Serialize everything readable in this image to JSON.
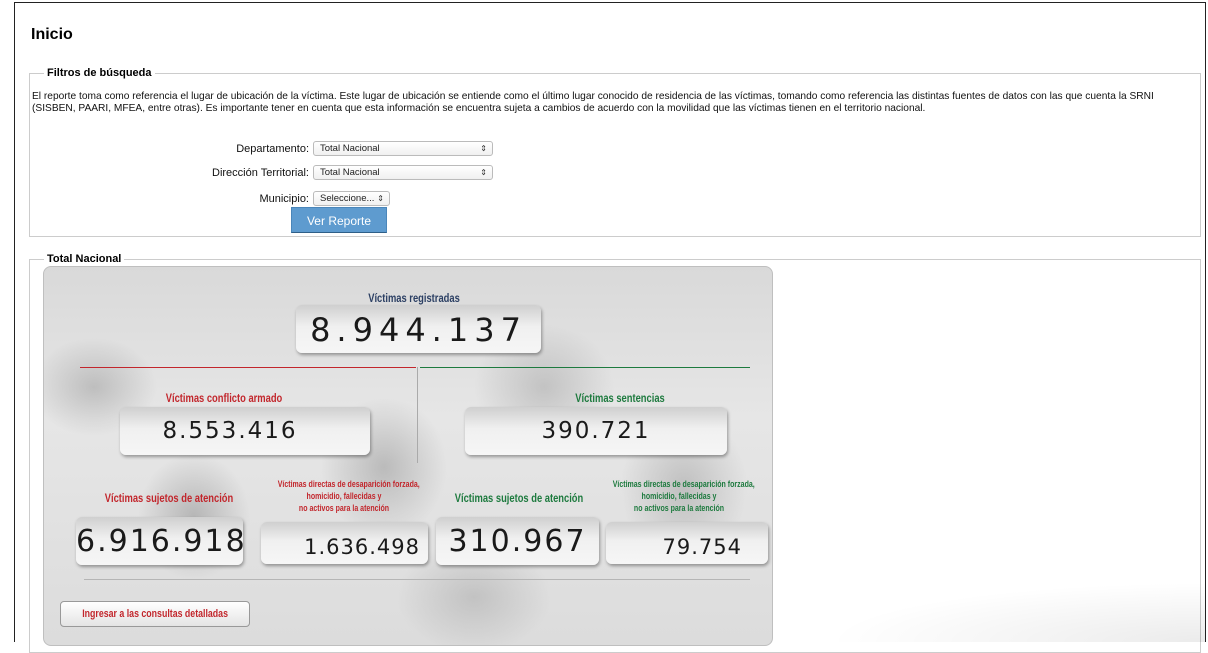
{
  "page": {
    "title": "Inicio"
  },
  "filters": {
    "legend": "Filtros de búsqueda",
    "description": "El reporte toma como referencia el lugar de ubicación de la víctima. Este lugar de ubicación se entiende como el último lugar conocido de residencia de las víctimas, tomando como referencia las distintas fuentes de datos con las que cuenta la SRNI (SISBEN, PAARI, MFEA, entre otras). Es importante tener en cuenta que esta información se encuentra sujeta a cambios de acuerdo con la movilidad que las víctimas tienen en el territorio nacional.",
    "departamento_label": "Departamento:",
    "departamento_value": "Total Nacional",
    "direccion_label": "Dirección Territorial:",
    "direccion_value": "Total Nacional",
    "municipio_label": "Municipio:",
    "municipio_value": "Seleccione...",
    "submit_label": "Ver Reporte"
  },
  "total": {
    "legend": "Total Nacional",
    "registradas_label": "Víctimas registradas",
    "registradas_value": "8.944.137",
    "conflicto_label": "Víctimas conflicto armado",
    "conflicto_value": "8.553.416",
    "sentencias_label": "Víctimas sentencias",
    "sentencias_value": "390.721",
    "sujetos_conflicto_label": "Víctimas sujetos de atención",
    "sujetos_conflicto_value": "6.916.918",
    "directas_conflicto_label_1": "Víctimas directas de desaparición forzada,",
    "directas_conflicto_label_2": "homicidio, fallecidas y",
    "directas_conflicto_label_3": "no activos para la atención",
    "directas_conflicto_value": "1.636.498",
    "sujetos_sentencias_label": "Víctimas sujetos de atención",
    "sujetos_sentencias_value": "310.967",
    "directas_sentencias_label_1": "Víctimas directas de desaparición forzada,",
    "directas_sentencias_label_2": "homicidio, fallecidas y",
    "directas_sentencias_label_3": "no activos para la atención",
    "directas_sentencias_value": "79.754",
    "consult_link": "Ingresar a las consultas detalladas"
  },
  "colors": {
    "red": "#c2262c",
    "green": "#1d7a3e",
    "navy": "#2b3f63",
    "button": "#5e9bcf"
  },
  "icons": {
    "select_arrows": "updown-arrows-icon"
  }
}
